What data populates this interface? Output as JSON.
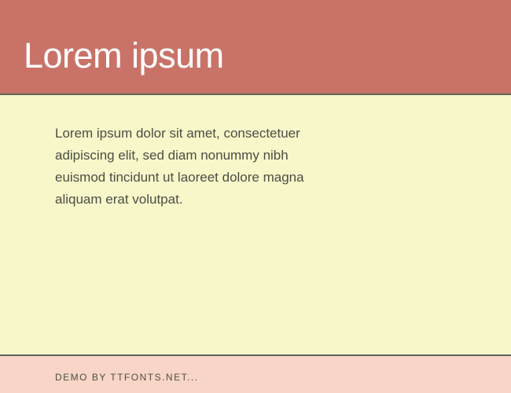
{
  "header": {
    "title": "Lorem ipsum"
  },
  "content": {
    "body": "Lorem ipsum dolor sit amet, consectetuer adipiscing elit, sed diam nonummy nibh euismod tincidunt ut laoreet dolore magna aliquam erat volutpat."
  },
  "footer": {
    "credit": "DEMO BY TTFONTS.NET..."
  }
}
